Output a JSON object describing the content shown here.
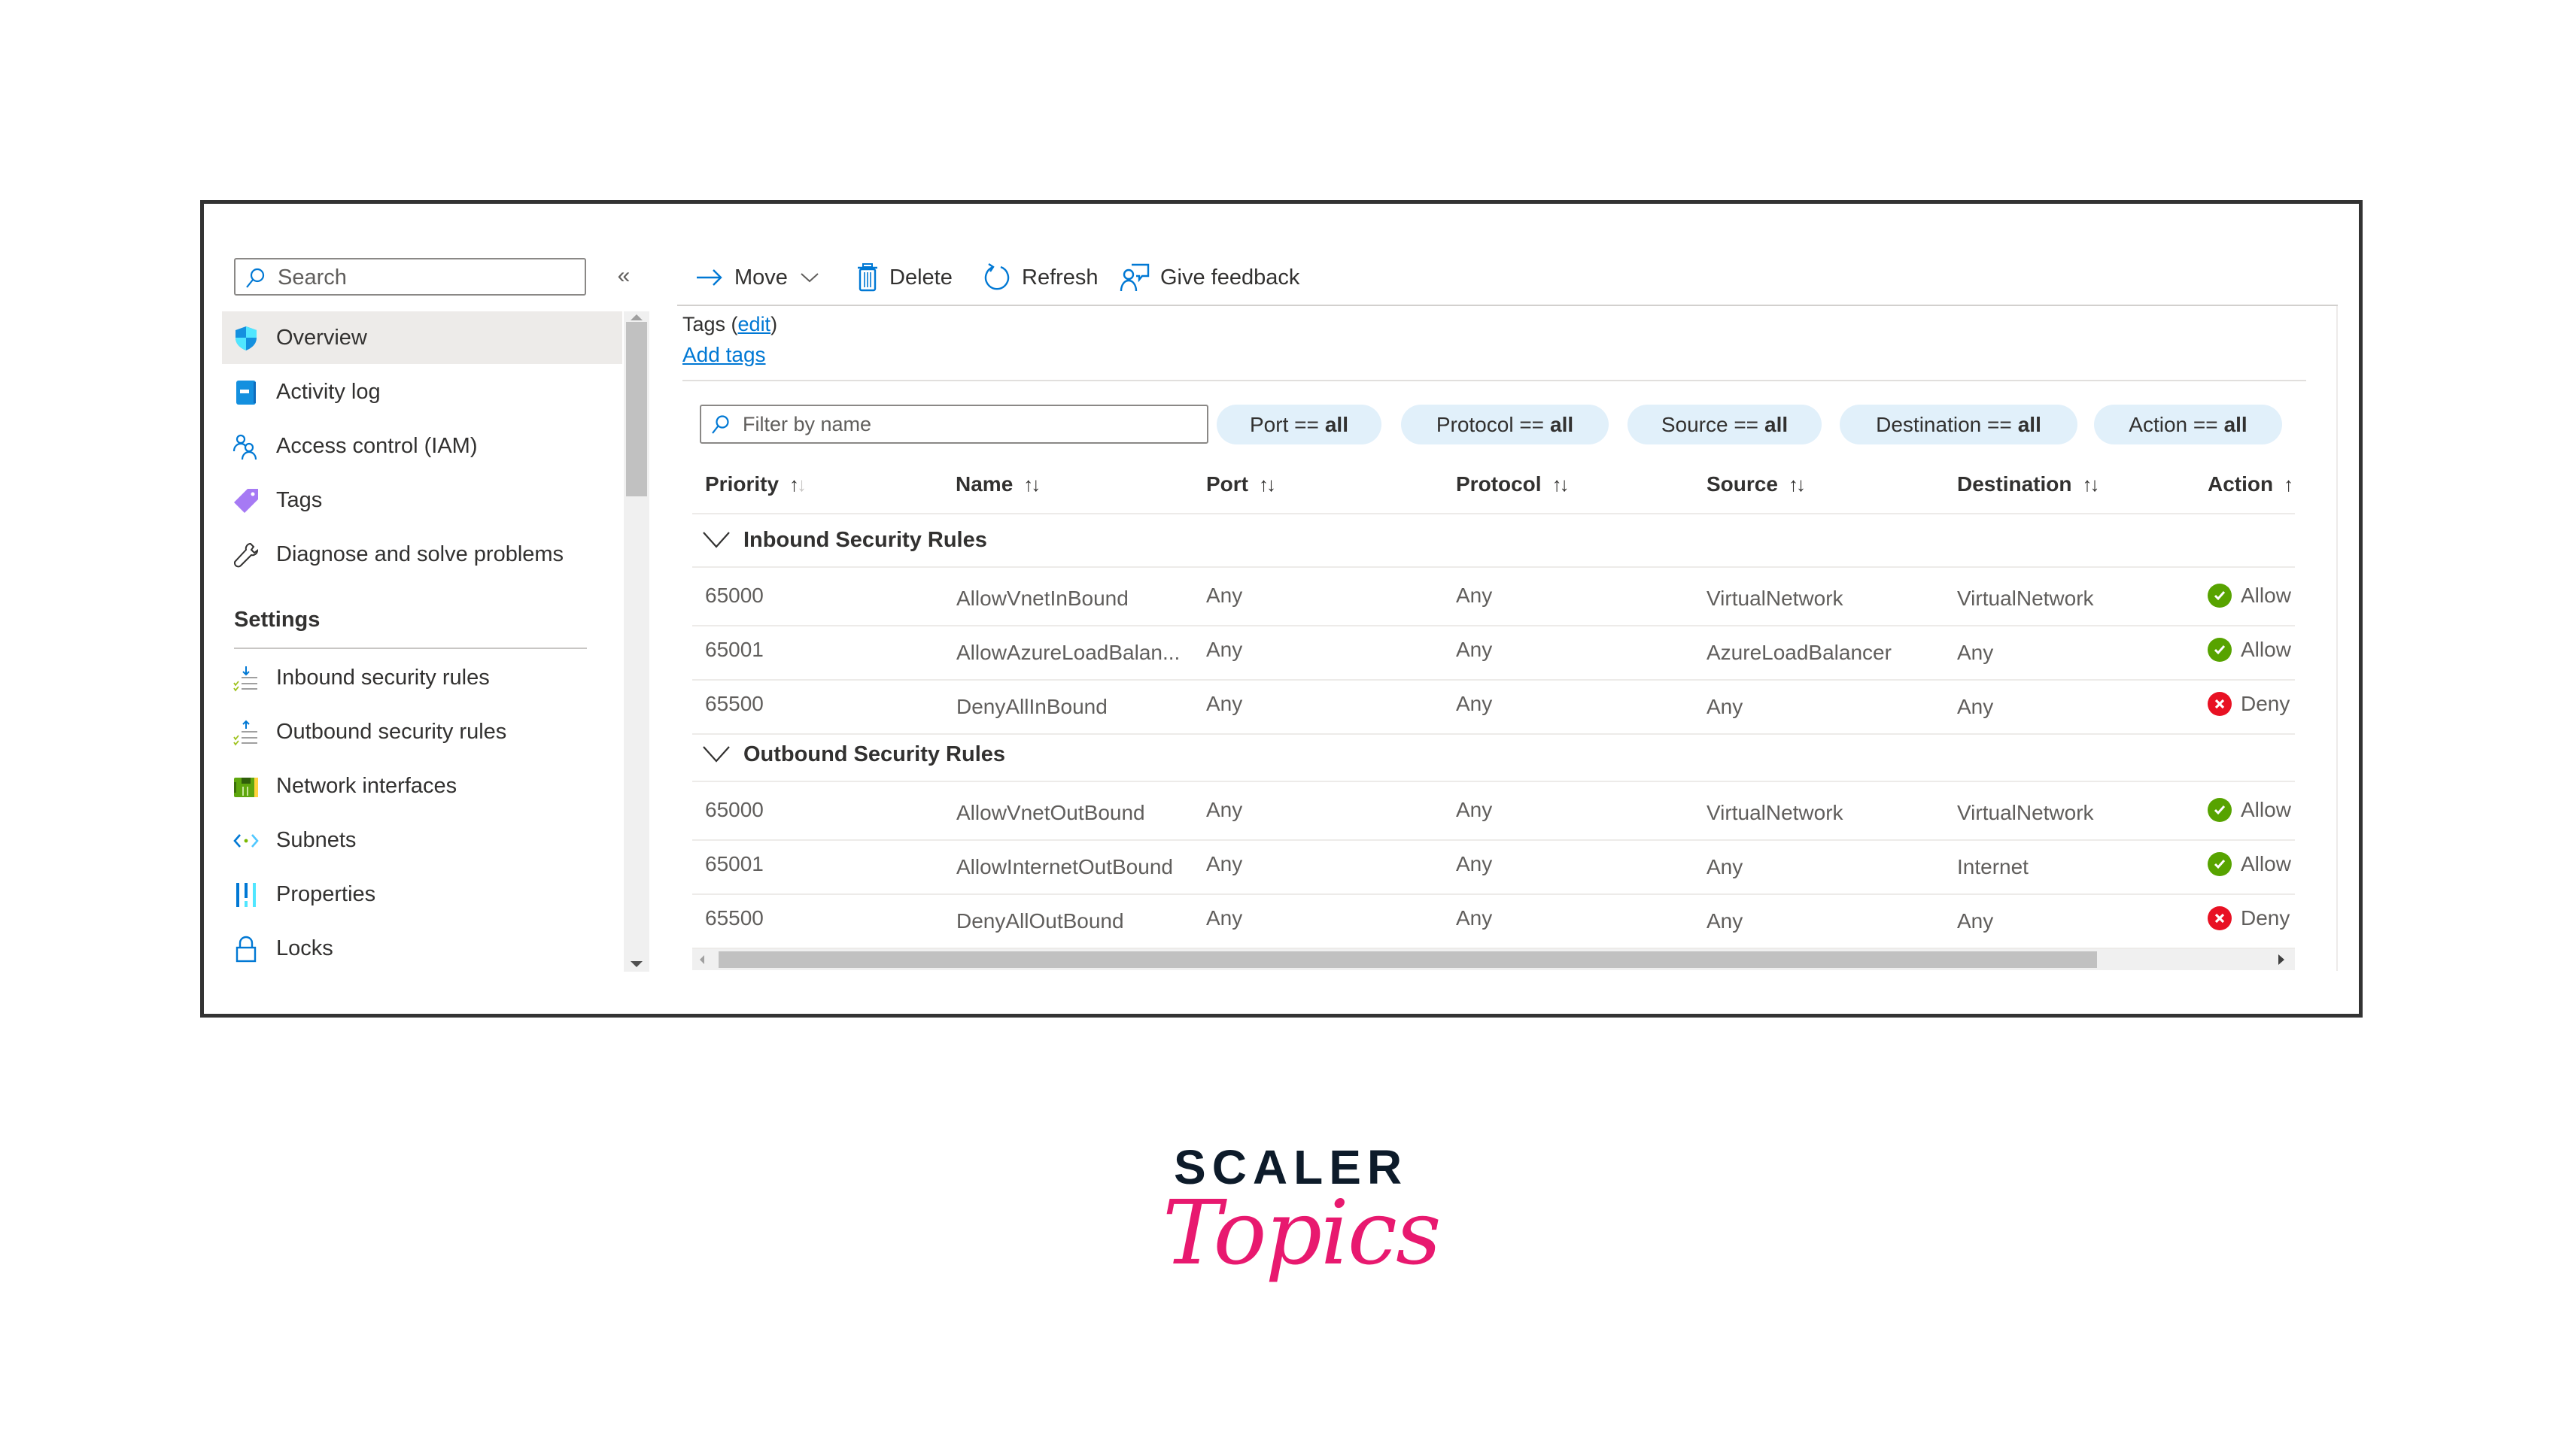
{
  "sidebar": {
    "search_placeholder": "Search",
    "collapse_glyph": "«",
    "items": [
      {
        "label": "Overview",
        "icon": "shield-icon",
        "active": true
      },
      {
        "label": "Activity log",
        "icon": "activity-log-icon"
      },
      {
        "label": "Access control (IAM)",
        "icon": "people-icon"
      },
      {
        "label": "Tags",
        "icon": "tag-icon"
      },
      {
        "label": "Diagnose and solve problems",
        "icon": "wrench-icon"
      }
    ],
    "settings_header": "Settings",
    "settings_items": [
      {
        "label": "Inbound security rules",
        "icon": "inbound-rules-icon"
      },
      {
        "label": "Outbound security rules",
        "icon": "outbound-rules-icon"
      },
      {
        "label": "Network interfaces",
        "icon": "network-interface-icon"
      },
      {
        "label": "Subnets",
        "icon": "subnet-icon"
      },
      {
        "label": "Properties",
        "icon": "properties-icon"
      },
      {
        "label": "Locks",
        "icon": "lock-icon"
      }
    ]
  },
  "toolbar": {
    "move": "Move",
    "delete": "Delete",
    "refresh": "Refresh",
    "feedback": "Give feedback"
  },
  "tags": {
    "label": "Tags (",
    "edit": "edit",
    "close": ")",
    "add": "Add tags"
  },
  "filters": {
    "placeholder": "Filter by name",
    "pills": [
      {
        "field": "Port ==",
        "value": "all"
      },
      {
        "field": "Protocol ==",
        "value": "all"
      },
      {
        "field": "Source ==",
        "value": "all"
      },
      {
        "field": "Destination ==",
        "value": "all"
      },
      {
        "field": "Action ==",
        "value": "all"
      }
    ]
  },
  "table": {
    "columns": [
      "Priority",
      "Name",
      "Port",
      "Protocol",
      "Source",
      "Destination",
      "Action"
    ],
    "sort_glyph_up": "↑",
    "sort_glyph_down": "↓",
    "groups": [
      {
        "title": "Inbound Security Rules",
        "rows": [
          {
            "priority": "65000",
            "name": "AllowVnetInBound",
            "port": "Any",
            "protocol": "Any",
            "source": "VirtualNetwork",
            "destination": "VirtualNetwork",
            "action": "Allow"
          },
          {
            "priority": "65001",
            "name": "AllowAzureLoadBalan...",
            "port": "Any",
            "protocol": "Any",
            "source": "AzureLoadBalancer",
            "destination": "Any",
            "action": "Allow"
          },
          {
            "priority": "65500",
            "name": "DenyAllInBound",
            "port": "Any",
            "protocol": "Any",
            "source": "Any",
            "destination": "Any",
            "action": "Deny"
          }
        ]
      },
      {
        "title": "Outbound Security Rules",
        "rows": [
          {
            "priority": "65000",
            "name": "AllowVnetOutBound",
            "port": "Any",
            "protocol": "Any",
            "source": "VirtualNetwork",
            "destination": "VirtualNetwork",
            "action": "Allow"
          },
          {
            "priority": "65001",
            "name": "AllowInternetOutBound",
            "port": "Any",
            "protocol": "Any",
            "source": "Any",
            "destination": "Internet",
            "action": "Allow"
          },
          {
            "priority": "65500",
            "name": "DenyAllOutBound",
            "port": "Any",
            "protocol": "Any",
            "source": "Any",
            "destination": "Any",
            "action": "Deny"
          }
        ]
      }
    ]
  },
  "colors": {
    "accent": "#0078d4",
    "allow": "#57a300",
    "deny": "#e81123",
    "pill_bg": "#e1f0fa",
    "brand_pink": "#e8196f",
    "brand_dark": "#0d1b2a"
  },
  "logo": {
    "top": "SCALER",
    "script": "Topics"
  }
}
